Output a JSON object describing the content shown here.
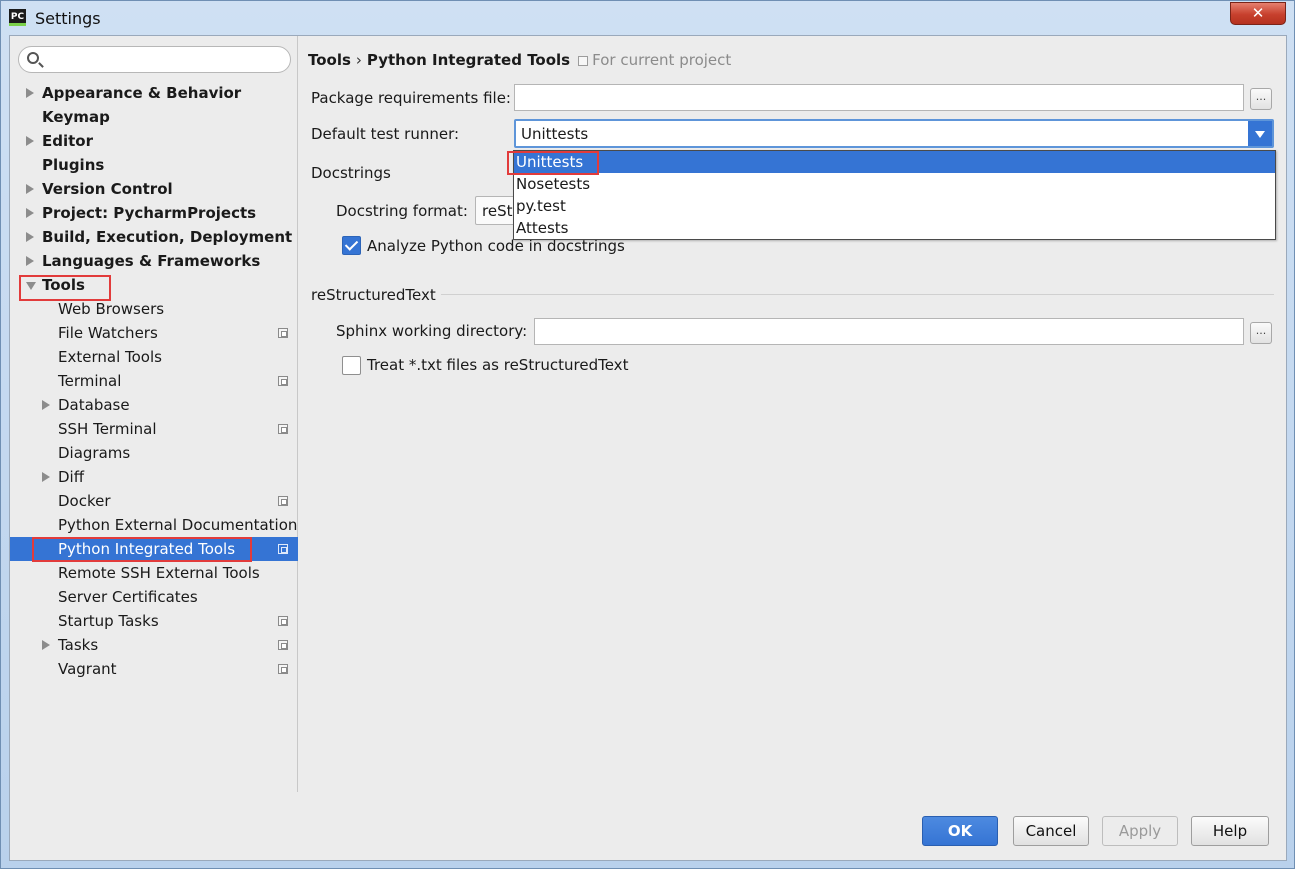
{
  "window": {
    "title": "Settings",
    "app_icon_text": "PC",
    "close_glyph": "✕"
  },
  "sidebar": {
    "search_placeholder": "",
    "items": [
      {
        "label": "Appearance & Behavior",
        "level": 0,
        "bold": true,
        "expandable": true,
        "expanded": false,
        "project_icon": false
      },
      {
        "label": "Keymap",
        "level": 0,
        "bold": true,
        "expandable": false,
        "expanded": false,
        "project_icon": false
      },
      {
        "label": "Editor",
        "level": 0,
        "bold": true,
        "expandable": true,
        "expanded": false,
        "project_icon": false
      },
      {
        "label": "Plugins",
        "level": 0,
        "bold": true,
        "expandable": false,
        "expanded": false,
        "project_icon": false
      },
      {
        "label": "Version Control",
        "level": 0,
        "bold": true,
        "expandable": true,
        "expanded": false,
        "project_icon": false
      },
      {
        "label": "Project: PycharmProjects",
        "level": 0,
        "bold": true,
        "expandable": true,
        "expanded": false,
        "project_icon": false
      },
      {
        "label": "Build, Execution, Deployment",
        "level": 0,
        "bold": true,
        "expandable": true,
        "expanded": false,
        "project_icon": false
      },
      {
        "label": "Languages & Frameworks",
        "level": 0,
        "bold": true,
        "expandable": true,
        "expanded": false,
        "project_icon": false
      },
      {
        "label": "Tools",
        "level": 0,
        "bold": true,
        "expandable": true,
        "expanded": true,
        "project_icon": false
      },
      {
        "label": "Web Browsers",
        "level": 1,
        "bold": false,
        "expandable": false,
        "expanded": false,
        "project_icon": false
      },
      {
        "label": "File Watchers",
        "level": 1,
        "bold": false,
        "expandable": false,
        "expanded": false,
        "project_icon": true
      },
      {
        "label": "External Tools",
        "level": 1,
        "bold": false,
        "expandable": false,
        "expanded": false,
        "project_icon": false
      },
      {
        "label": "Terminal",
        "level": 1,
        "bold": false,
        "expandable": false,
        "expanded": false,
        "project_icon": true
      },
      {
        "label": "Database",
        "level": 1,
        "bold": false,
        "expandable": true,
        "expanded": false,
        "project_icon": false
      },
      {
        "label": "SSH Terminal",
        "level": 1,
        "bold": false,
        "expandable": false,
        "expanded": false,
        "project_icon": true
      },
      {
        "label": "Diagrams",
        "level": 1,
        "bold": false,
        "expandable": false,
        "expanded": false,
        "project_icon": false
      },
      {
        "label": "Diff",
        "level": 1,
        "bold": false,
        "expandable": true,
        "expanded": false,
        "project_icon": false
      },
      {
        "label": "Docker",
        "level": 1,
        "bold": false,
        "expandable": false,
        "expanded": false,
        "project_icon": true
      },
      {
        "label": "Python External Documentation",
        "level": 1,
        "bold": false,
        "expandable": false,
        "expanded": false,
        "project_icon": false
      },
      {
        "label": "Python Integrated Tools",
        "level": 1,
        "bold": false,
        "expandable": false,
        "expanded": false,
        "project_icon": true,
        "selected": true
      },
      {
        "label": "Remote SSH External Tools",
        "level": 1,
        "bold": false,
        "expandable": false,
        "expanded": false,
        "project_icon": false
      },
      {
        "label": "Server Certificates",
        "level": 1,
        "bold": false,
        "expandable": false,
        "expanded": false,
        "project_icon": false
      },
      {
        "label": "Startup Tasks",
        "level": 1,
        "bold": false,
        "expandable": false,
        "expanded": false,
        "project_icon": true
      },
      {
        "label": "Tasks",
        "level": 1,
        "bold": false,
        "expandable": true,
        "expanded": false,
        "project_icon": true
      },
      {
        "label": "Vagrant",
        "level": 1,
        "bold": false,
        "expandable": false,
        "expanded": false,
        "project_icon": true
      }
    ]
  },
  "main": {
    "breadcrumb": {
      "parent": "Tools",
      "separator": "›",
      "current": "Python Integrated Tools",
      "scope": "For current project"
    },
    "package_requirements": {
      "label": "Package requirements file:",
      "value": "",
      "browse_label": "..."
    },
    "test_runner": {
      "label": "Default test runner:",
      "value": "Unittests",
      "options": [
        "Unittests",
        "Nosetests",
        "py.test",
        "Attests"
      ],
      "selected_index": 0
    },
    "docstrings": {
      "section_title": "Docstrings",
      "format_label": "Docstring format:",
      "format_value": "reSt",
      "analyze_label": "Analyze Python code in docstrings",
      "analyze_checked": true
    },
    "restructured_text": {
      "section_title": "reStructuredText",
      "sphinx_label": "Sphinx working directory:",
      "sphinx_value": "",
      "browse_label": "...",
      "treat_txt_label": "Treat *.txt files as reStructuredText",
      "treat_txt_checked": false
    }
  },
  "footer": {
    "ok": "OK",
    "cancel": "Cancel",
    "apply": "Apply",
    "help": "Help"
  },
  "colors": {
    "selection": "#3574d4",
    "highlight_box": "#e23b3b",
    "panel_bg": "#ececec"
  }
}
